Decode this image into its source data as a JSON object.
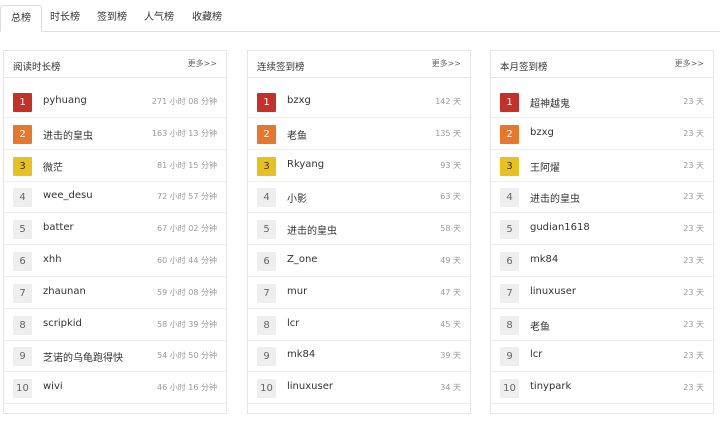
{
  "tabs": [
    "总榜",
    "时长榜",
    "签到榜",
    "人气榜",
    "收藏榜"
  ],
  "more_label": "更多>>",
  "panels": [
    {
      "title": "阅读时长榜",
      "rows": [
        {
          "rank": "1",
          "name": "pyhuang",
          "value": "271 小时 08 分钟"
        },
        {
          "rank": "2",
          "name": "进击的皇虫",
          "value": "163 小时 13 分钟"
        },
        {
          "rank": "3",
          "name": "微茫",
          "value": "81 小时 15 分钟"
        },
        {
          "rank": "4",
          "name": "wee_desu",
          "value": "72 小时 57 分钟"
        },
        {
          "rank": "5",
          "name": "batter",
          "value": "67 小时 02 分钟"
        },
        {
          "rank": "6",
          "name": "xhh",
          "value": "60 小时 44 分钟"
        },
        {
          "rank": "7",
          "name": "zhaunan",
          "value": "59 小时 08 分钟"
        },
        {
          "rank": "8",
          "name": "scripkid",
          "value": "58 小时 39 分钟"
        },
        {
          "rank": "9",
          "name": "芝诺的乌龟跑得快",
          "value": "54 小时 50 分钟"
        },
        {
          "rank": "10",
          "name": "wivi",
          "value": "46 小时 16 分钟"
        }
      ]
    },
    {
      "title": "连续签到榜",
      "rows": [
        {
          "rank": "1",
          "name": "bzxg",
          "value": "142 天"
        },
        {
          "rank": "2",
          "name": "老鱼",
          "value": "135 天"
        },
        {
          "rank": "3",
          "name": "Rkyang",
          "value": "93 天"
        },
        {
          "rank": "4",
          "name": "小影",
          "value": "63 天"
        },
        {
          "rank": "5",
          "name": "进击的皇虫",
          "value": "58 天"
        },
        {
          "rank": "6",
          "name": "Z_one",
          "value": "49 天"
        },
        {
          "rank": "7",
          "name": "mur",
          "value": "47 天"
        },
        {
          "rank": "8",
          "name": "lcr",
          "value": "45 天"
        },
        {
          "rank": "9",
          "name": "mk84",
          "value": "39 天"
        },
        {
          "rank": "10",
          "name": "linuxuser",
          "value": "34 天"
        }
      ]
    },
    {
      "title": "本月签到榜",
      "rows": [
        {
          "rank": "1",
          "name": "超神越鬼",
          "value": "23 天"
        },
        {
          "rank": "2",
          "name": "bzxg",
          "value": "23 天"
        },
        {
          "rank": "3",
          "name": "王阿燿",
          "value": "23 天"
        },
        {
          "rank": "4",
          "name": "进击的皇虫",
          "value": "23 天"
        },
        {
          "rank": "5",
          "name": "gudian1618",
          "value": "23 天"
        },
        {
          "rank": "6",
          "name": "mk84",
          "value": "23 天"
        },
        {
          "rank": "7",
          "name": "linuxuser",
          "value": "23 天"
        },
        {
          "rank": "8",
          "name": "老鱼",
          "value": "23 天"
        },
        {
          "rank": "9",
          "name": "lcr",
          "value": "23 天"
        },
        {
          "rank": "10",
          "name": "tinypark",
          "value": "23 天"
        }
      ]
    }
  ]
}
